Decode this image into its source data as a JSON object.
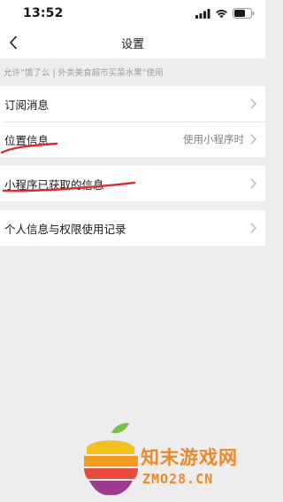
{
  "status_bar": {
    "time": "13:52"
  },
  "nav": {
    "title": "设置"
  },
  "allow_header": "允许“饿了么 | 外卖美食超市买菜水果”使用",
  "group1": {
    "items": [
      {
        "label": "订阅消息",
        "value": ""
      },
      {
        "label": "位置信息",
        "value": "使用小程序时"
      }
    ]
  },
  "group2": {
    "items": [
      {
        "label": "小程序已获取的信息"
      }
    ]
  },
  "group3": {
    "items": [
      {
        "label": "个人信息与权限使用记录"
      }
    ]
  },
  "watermark": {
    "name": "知末游戏网",
    "url": "ZMO28.CN"
  },
  "colors": {
    "page_background": "#ededed",
    "card_background": "#ffffff",
    "annotation_red": "#e8262f",
    "watermark_orange": "#e98a2a"
  },
  "icons": [
    "signal-icon",
    "wifi-icon",
    "battery-icon",
    "back-arrow-icon",
    "chevron-right-icon",
    "apple-logo-icon"
  ]
}
